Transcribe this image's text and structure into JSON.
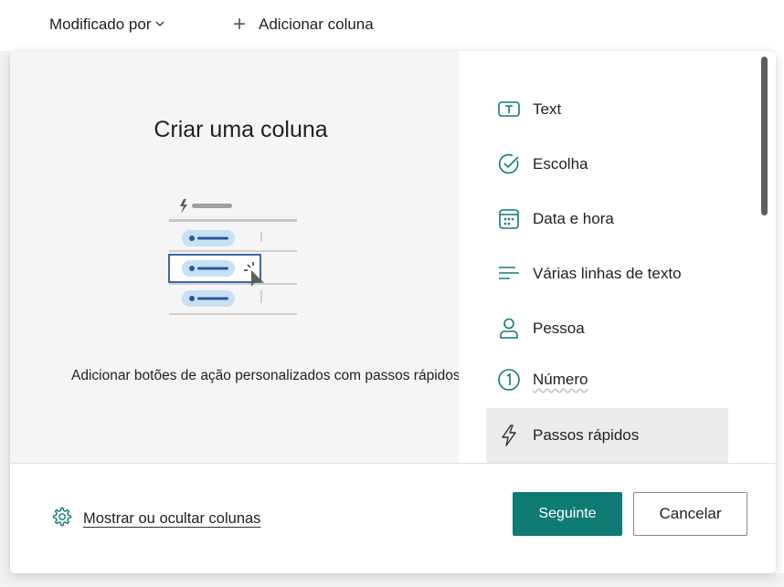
{
  "background": {
    "modified_by": "Modificado por",
    "add_column": "Adicionar coluna"
  },
  "dialog": {
    "title": "Criar uma coluna",
    "description": "Adicionar botões de ação personalizados com passos rápidos",
    "column_types": [
      {
        "label": "Text",
        "icon": "text-icon",
        "selected": false
      },
      {
        "label": "Escolha",
        "icon": "choice-check-icon",
        "selected": false
      },
      {
        "label": "Data e hora",
        "icon": "calendar-icon",
        "selected": false
      },
      {
        "label": "Várias linhas de texto",
        "icon": "multiline-text-icon",
        "selected": false
      },
      {
        "label": "Pessoa",
        "icon": "person-icon",
        "selected": false
      },
      {
        "label": "Número",
        "icon": "number-icon",
        "selected": false
      },
      {
        "label": "Passos rápidos",
        "icon": "lightning-icon",
        "selected": true
      }
    ],
    "footer": {
      "show_hide": "Mostrar ou ocultar colunas",
      "next": "Seguinte",
      "cancel": "Cancelar"
    }
  },
  "colors": {
    "accent": "#0f7b75",
    "selected_bg": "#edebe9",
    "left_pane_bg": "#f5f5f5"
  }
}
